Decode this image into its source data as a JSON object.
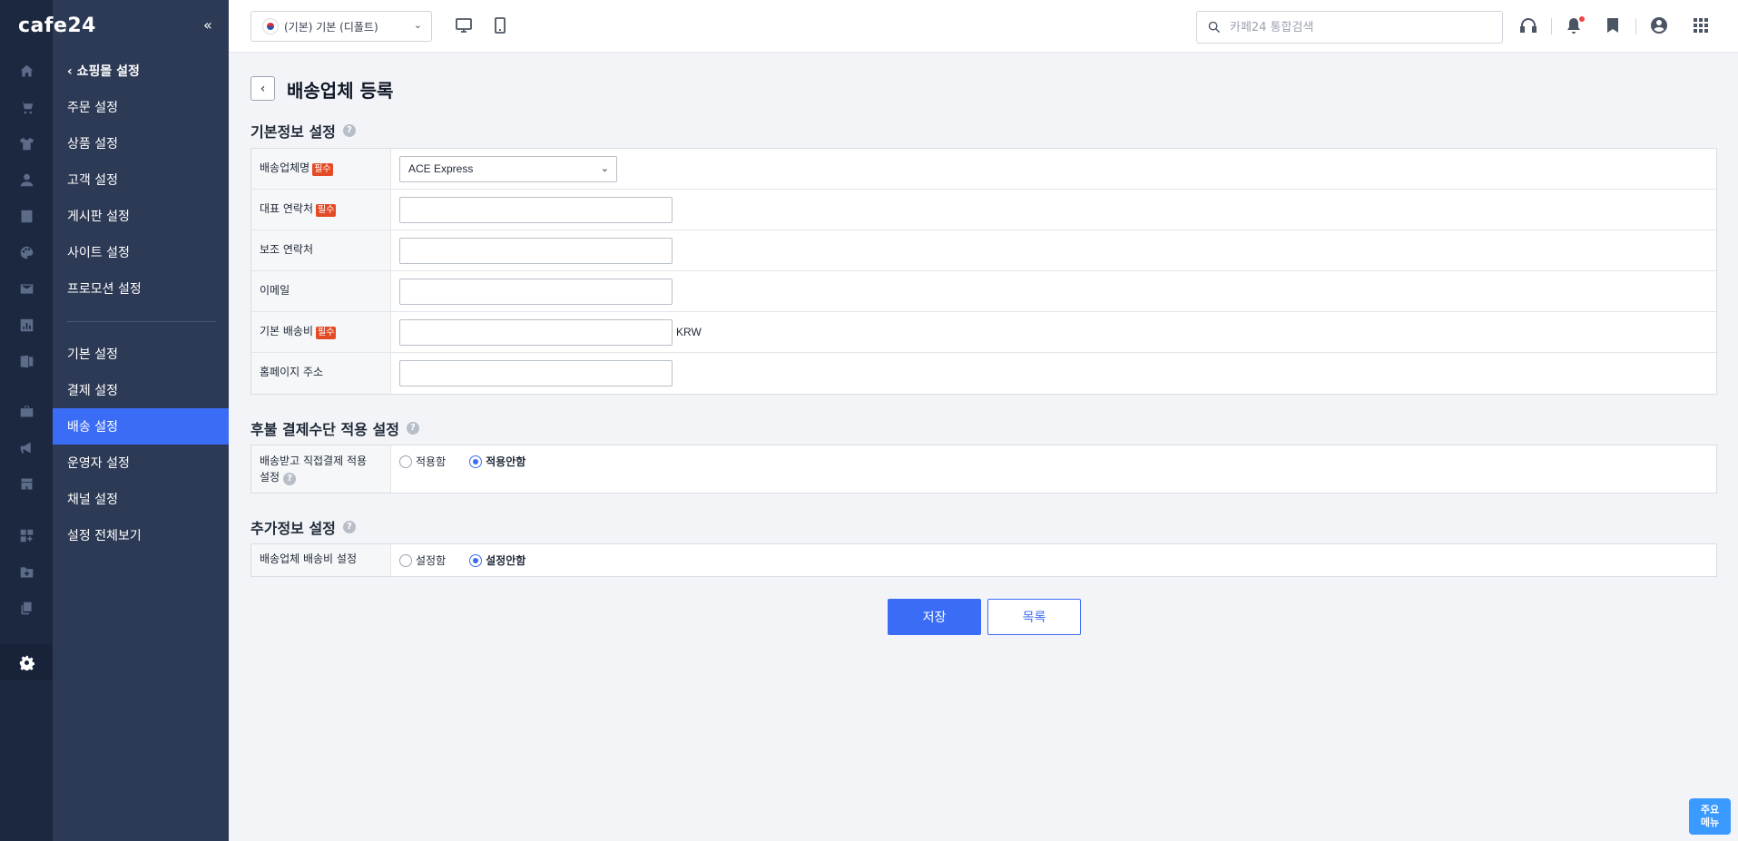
{
  "brand": "cafe24",
  "collapse_label": "«",
  "subnav": {
    "header": "쇼핑몰 설정",
    "group1": [
      "주문 설정",
      "상품 설정",
      "고객 설정",
      "게시판 설정",
      "사이트 설정",
      "프로모션 설정"
    ],
    "group2": [
      "기본 설정",
      "결제 설정",
      "배송 설정",
      "운영자 설정",
      "채널 설정",
      "설정 전체보기"
    ],
    "active": "배송 설정"
  },
  "rail_icons": [
    "home-icon",
    "cart-icon",
    "shirt-icon",
    "user-icon",
    "board-icon",
    "palette-icon",
    "mail-icon",
    "chart-icon",
    "excel-icon",
    "briefcase-icon",
    "megaphone-icon",
    "store-add-icon",
    "apps-add-icon",
    "folder-add-icon",
    "copy-icon",
    "gear-icon"
  ],
  "topbar": {
    "shop_select": "(기본) 기본 (디폴트)",
    "search_placeholder": "카페24 통합검색"
  },
  "page": {
    "title": "배송업체 등록",
    "back_label": "‹"
  },
  "basic_section": {
    "title": "기본정보 설정",
    "help": "?",
    "required_badge": "필수",
    "rows": {
      "carrier_label": "배송업체명",
      "carrier_value": "ACE Express",
      "phone_label": "대표 연락처",
      "phone2_label": "보조 연락처",
      "email_label": "이메일",
      "fee_label": "기본 배송비",
      "fee_unit": "KRW",
      "homepage_label": "홈페이지 주소"
    }
  },
  "deferred_section": {
    "title": "후불 결제수단 적용 설정",
    "help": "?",
    "row_label_line1": "배송받고 직접결제 적용",
    "row_label_line2": "설정",
    "option_apply": "적용함",
    "option_not_apply": "적용안함",
    "selected": "적용안함"
  },
  "extra_section": {
    "title": "추가정보 설정",
    "help": "?",
    "row_label": "배송업체 배송비 설정",
    "option_set": "설정함",
    "option_not_set": "설정안함",
    "selected": "설정안함"
  },
  "buttons": {
    "save": "저장",
    "list": "목록"
  },
  "quick_menu": {
    "line1": "주요",
    "line2": "메뉴"
  },
  "colors": {
    "primary": "#3b6cf6",
    "sidebar": "#2d3a55",
    "rail": "#1c2840",
    "required": "#e34b27"
  }
}
